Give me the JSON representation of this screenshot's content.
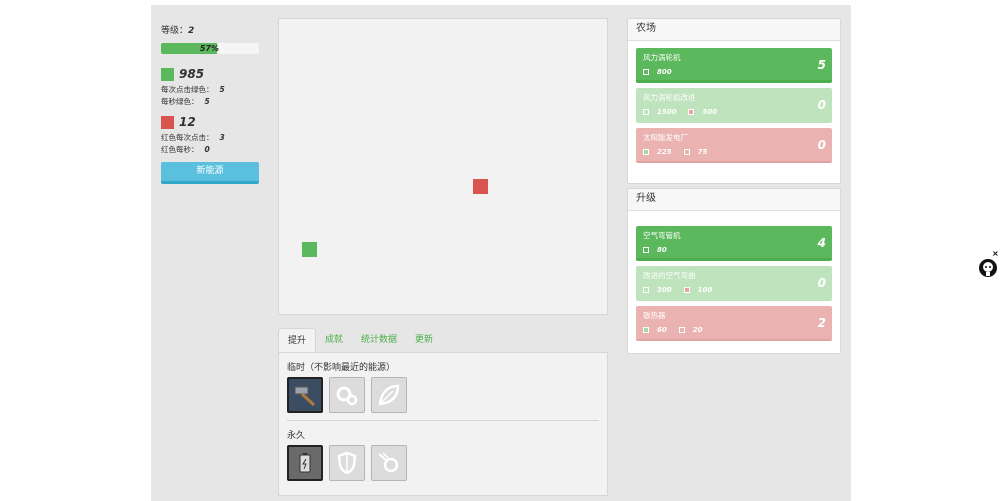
{
  "left": {
    "level_label": "等级：",
    "level_value": "2",
    "progress_text": "57%",
    "progress_fraction": 0.57,
    "green_count": "985",
    "green_per_click_label": "每次点击绿色：",
    "green_per_click": "5",
    "green_per_sec_label": "每秒绿色：",
    "green_per_sec": "5",
    "red_count": "12",
    "red_per_click_label": "红色每次点击：",
    "red_per_click": "3",
    "red_per_sec_label": "红色每秒：",
    "red_per_sec": "0",
    "new_energy_button": "新能源"
  },
  "colors": {
    "green": "#5cb85c",
    "red": "#d9534f",
    "blue": "#5bc0de"
  },
  "tabs": {
    "items": [
      "提升",
      "成就",
      "统计数据",
      "更新"
    ],
    "temporary_title": "临时（不影响最近的能源）",
    "permanent_title": "永久",
    "temporary_icons": [
      "hammer-icon",
      "gears-icon",
      "leaf-icon"
    ],
    "permanent_icons": [
      "battery-icon",
      "shield-icon",
      "meteor-icon"
    ]
  },
  "farm": {
    "title": "农场",
    "items": [
      {
        "name": "风力涡轮机",
        "cost1": "800",
        "cost2": "",
        "count": "5"
      },
      {
        "name": "风力涡轮机改进",
        "cost1": "1500",
        "cost2": "500",
        "count": "0"
      },
      {
        "name": "太阳能发电厂",
        "cost1": "225",
        "cost2": "75",
        "count": "0"
      }
    ]
  },
  "upgrades": {
    "title": "升级",
    "items": [
      {
        "name": "空气弯管机",
        "cost1": "80",
        "cost2": "",
        "count": "4"
      },
      {
        "name": "改进的空气弯曲",
        "cost1": "300",
        "cost2": "100",
        "count": "0"
      },
      {
        "name": "散热器",
        "cost1": "60",
        "cost2": "20",
        "count": "2"
      }
    ]
  },
  "misc": {
    "close_mark": "×",
    "corner_icon": "octocat-icon"
  }
}
